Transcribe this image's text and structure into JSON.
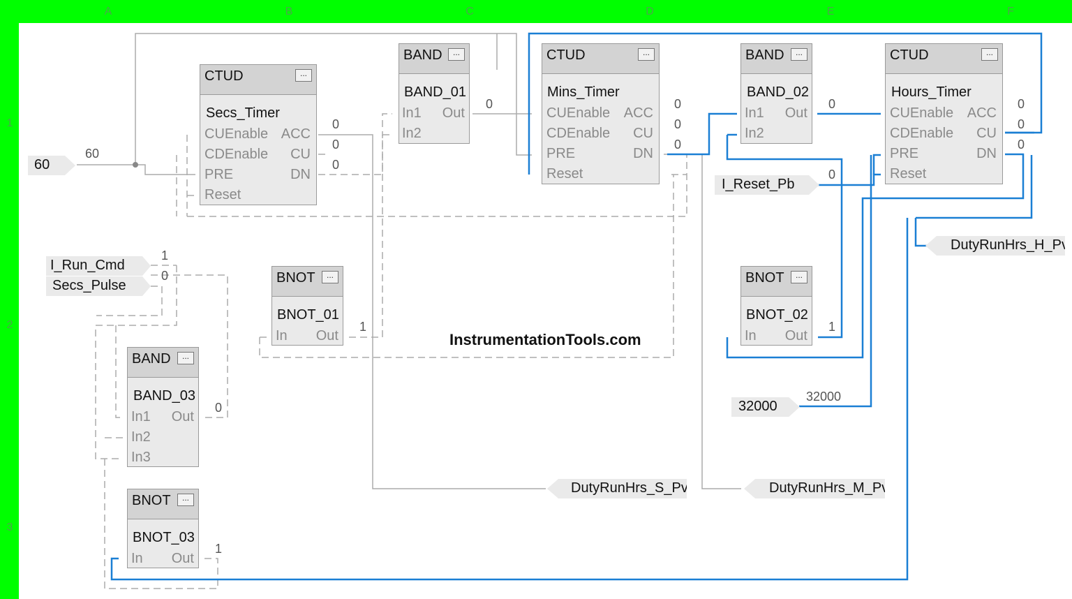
{
  "columns": [
    "A",
    "B",
    "C",
    "D",
    "E",
    "F"
  ],
  "rows": [
    "1",
    "2",
    "3"
  ],
  "watermark": "InstrumentationTools.com",
  "blocks": [
    {
      "type": "CTUD",
      "name": "Secs_Timer",
      "pins_in": [
        "CUEnable",
        "CDEnable",
        "PRE",
        "Reset"
      ],
      "pins_out": [
        "ACC",
        "CU",
        "DN"
      ],
      "out_values": [
        "0",
        "0",
        "0"
      ]
    },
    {
      "type": "BAND",
      "name": "BAND_01",
      "pins_in": [
        "In1",
        "In2"
      ],
      "pins_out": [
        "Out"
      ],
      "out_values": [
        "0"
      ]
    },
    {
      "type": "CTUD",
      "name": "Mins_Timer",
      "pins_in": [
        "CUEnable",
        "CDEnable",
        "PRE",
        "Reset"
      ],
      "pins_out": [
        "ACC",
        "CU",
        "DN"
      ],
      "out_values": [
        "0",
        "0",
        "0"
      ]
    },
    {
      "type": "BAND",
      "name": "BAND_02",
      "pins_in": [
        "In1",
        "In2"
      ],
      "pins_out": [
        "Out"
      ],
      "out_values": [
        "0"
      ]
    },
    {
      "type": "CTUD",
      "name": "Hours_Timer",
      "pins_in": [
        "CUEnable",
        "CDEnable",
        "PRE",
        "Reset"
      ],
      "pins_out": [
        "ACC",
        "CU",
        "DN"
      ],
      "out_values": [
        "0",
        "0",
        "0"
      ]
    },
    {
      "type": "BNOT",
      "name": "BNOT_01",
      "pins_in": [
        "In"
      ],
      "pins_out": [
        "Out"
      ],
      "out_values": [
        "1"
      ]
    },
    {
      "type": "BNOT",
      "name": "BNOT_02",
      "pins_in": [
        "In"
      ],
      "pins_out": [
        "Out"
      ],
      "out_values": [
        "1"
      ]
    },
    {
      "type": "BAND",
      "name": "BAND_03",
      "pins_in": [
        "In1",
        "In2",
        "In3"
      ],
      "pins_out": [
        "Out"
      ],
      "out_values": [
        "0"
      ]
    },
    {
      "type": "BNOT",
      "name": "BNOT_03",
      "pins_in": [
        "In"
      ],
      "pins_out": [
        "Out"
      ],
      "out_values": [
        "1"
      ]
    }
  ],
  "input_refs": [
    {
      "label": "60",
      "value": "60"
    },
    {
      "label": "I_Run_Cmd",
      "value": "1"
    },
    {
      "label": "Secs_Pulse",
      "value": "0"
    },
    {
      "label": "I_Reset_Pb",
      "value": "0"
    },
    {
      "label": "32000",
      "value": "32000"
    }
  ],
  "output_refs": [
    {
      "label": "DutyRunHrs_S_Pv"
    },
    {
      "label": "DutyRunHrs_M_Pv"
    },
    {
      "label": "DutyRunHrs_H_Pv"
    }
  ],
  "dots_label": "..."
}
